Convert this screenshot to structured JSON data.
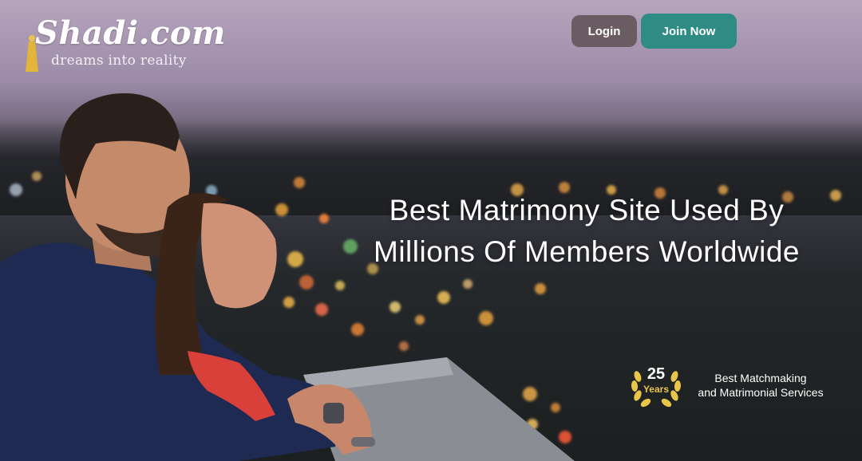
{
  "brand": {
    "name": "Shadi.com",
    "tagline": "dreams into reality"
  },
  "header": {
    "login_label": "Login",
    "join_label": "Join Now"
  },
  "hero": {
    "headline_line1": "Best Matrimony Site Used By",
    "headline_line2": "Millions Of Members Worldwide"
  },
  "badge": {
    "number": "25",
    "unit": "Years",
    "line1": "Best Matchmaking",
    "line2": "and Matrimonial Services"
  },
  "colors": {
    "login_bg": "#6b5c63",
    "join_bg": "#2f8c85",
    "badge_gold": "#e9c64a"
  },
  "icons": [
    "tassel-icon",
    "laurel-wreath-icon"
  ]
}
